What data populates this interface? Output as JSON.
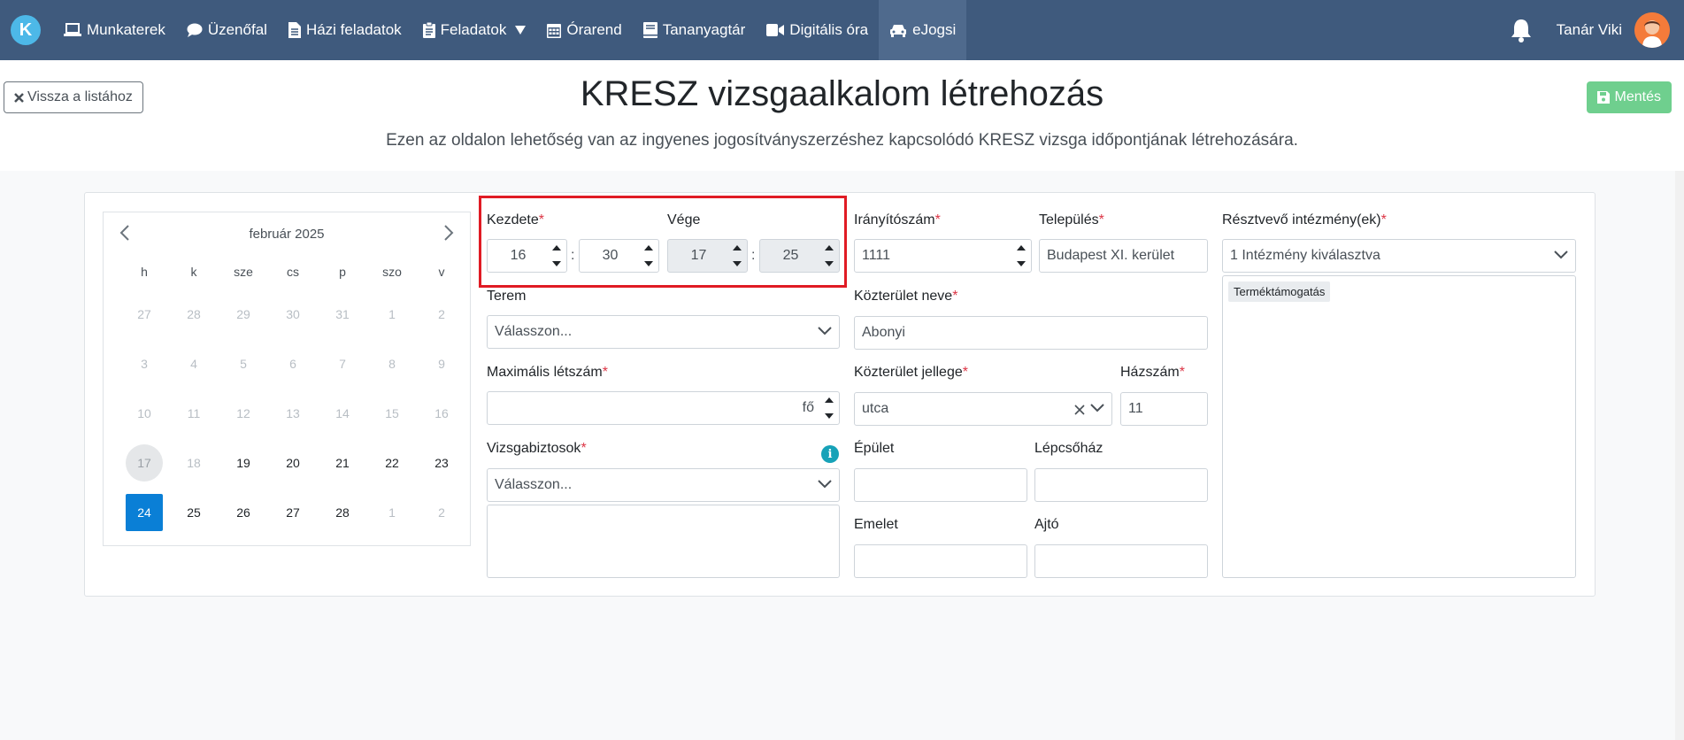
{
  "nav": {
    "logo": "K",
    "items": [
      {
        "label": "Munkaterek",
        "icon": "laptop-icon"
      },
      {
        "label": "Üzenőfal",
        "icon": "chat-icon"
      },
      {
        "label": "Házi feladatok",
        "icon": "file-icon"
      },
      {
        "label": "Feladatok",
        "icon": "clipboard-icon"
      },
      {
        "label": "Órarend",
        "icon": "calendar-icon"
      },
      {
        "label": "Tananyagtár",
        "icon": "book-icon"
      },
      {
        "label": "Digitális óra",
        "icon": "video-icon"
      },
      {
        "label": "eJogsi",
        "icon": "car-icon"
      }
    ],
    "active": "eJogsi",
    "user_name": "Tanár Viki"
  },
  "header": {
    "back_label": "Vissza a listához",
    "save_label": "Mentés",
    "title": "KRESZ vizsgaalkalom létrehozás",
    "subtitle": "Ezen az oldalon lehetőség van az ingyenes jogosítványszerzéshez kapcsolódó KRESZ vizsga időpontjának létrehozására."
  },
  "calendar": {
    "month": "február 2025",
    "weekdays": [
      "h",
      "k",
      "sze",
      "cs",
      "p",
      "szo",
      "v"
    ],
    "weeks": [
      [
        "27",
        "28",
        "29",
        "30",
        "31",
        "1",
        "2"
      ],
      [
        "3",
        "4",
        "5",
        "6",
        "7",
        "8",
        "9"
      ],
      [
        "10",
        "11",
        "12",
        "13",
        "14",
        "15",
        "16"
      ],
      [
        "17",
        "18",
        "19",
        "20",
        "21",
        "22",
        "23"
      ],
      [
        "24",
        "25",
        "26",
        "27",
        "28",
        "1",
        "2"
      ]
    ],
    "today": "17",
    "selected": "24"
  },
  "form": {
    "start_label": "Kezdete",
    "start_hour": "16",
    "start_minute": "30",
    "end_label": "Vége",
    "end_hour": "17",
    "end_minute": "25",
    "room_label": "Terem",
    "room_placeholder": "Válasszon...",
    "max_label": "Maximális létszám",
    "max_unit": "fő",
    "examiners_label": "Vizsgabiztosok",
    "examiners_placeholder": "Válasszon...",
    "zip_label": "Irányítószám",
    "zip_value": "1111",
    "city_label": "Település",
    "city_value": "Budapest XI. kerület",
    "street_label": "Közterület neve",
    "street_value": "Abonyi",
    "street_type_label": "Közterület jellege",
    "street_type_value": "utca",
    "house_label": "Házszám",
    "house_value": "11",
    "building_label": "Épület",
    "stair_label": "Lépcsőház",
    "floor_label": "Emelet",
    "door_label": "Ajtó",
    "inst_label": "Résztvevő intézmény(ek)",
    "inst_value": "1 Intézmény kiválasztva",
    "inst_tag": "Terméktámogatás",
    "required_mark": "*",
    "colon": ":"
  }
}
